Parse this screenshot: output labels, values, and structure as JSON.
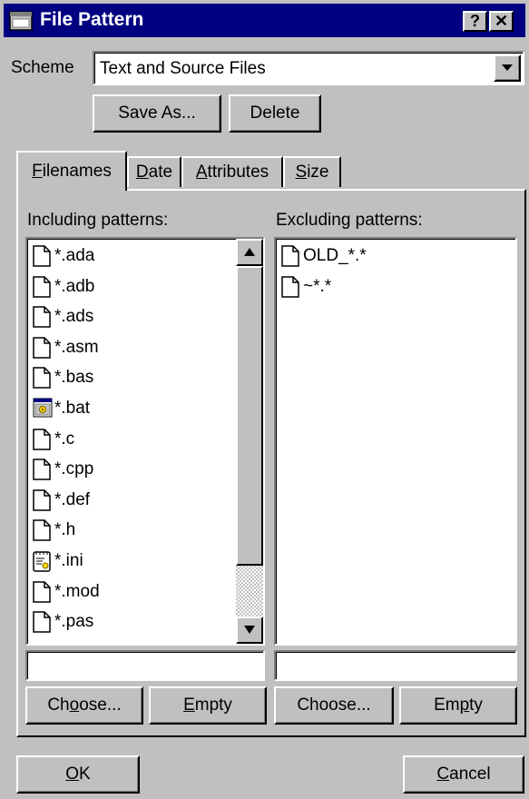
{
  "window": {
    "title": "File Pattern",
    "help_btn": "?",
    "close_btn": "✕"
  },
  "scheme": {
    "label": "Scheme",
    "value": "Text and Source Files",
    "save_as": "Save As...",
    "delete": "Delete"
  },
  "tabs": [
    {
      "label": "Filenames",
      "accel": "F",
      "rest": "ilenames"
    },
    {
      "label": "Date",
      "accel": "D",
      "rest": "ate"
    },
    {
      "label": "Attributes",
      "accel": "A",
      "rest": "ttributes"
    },
    {
      "label": "Size",
      "accel": "S",
      "rest": "ize"
    }
  ],
  "including": {
    "label": "Including patterns:",
    "items": [
      {
        "text": "*.ada",
        "icon": "document-icon"
      },
      {
        "text": "*.adb",
        "icon": "document-icon"
      },
      {
        "text": "*.ads",
        "icon": "document-icon"
      },
      {
        "text": "*.asm",
        "icon": "document-icon"
      },
      {
        "text": "*.bas",
        "icon": "document-icon"
      },
      {
        "text": "*.bat",
        "icon": "batch-file-icon"
      },
      {
        "text": "*.c",
        "icon": "document-icon"
      },
      {
        "text": "*.cpp",
        "icon": "document-icon"
      },
      {
        "text": "*.def",
        "icon": "document-icon"
      },
      {
        "text": "*.h",
        "icon": "document-icon"
      },
      {
        "text": "*.ini",
        "icon": "settings-file-icon"
      },
      {
        "text": "*.mod",
        "icon": "document-icon"
      },
      {
        "text": "*.pas",
        "icon": "document-icon"
      }
    ],
    "input_value": "",
    "choose_pre": "Ch",
    "choose_accel": "o",
    "choose_post": "ose...",
    "empty_accel": "E",
    "empty_post": "mpty"
  },
  "excluding": {
    "label": "Excluding patterns:",
    "items": [
      {
        "text": "OLD_*.*",
        "icon": "document-icon"
      },
      {
        "text": "~*.*",
        "icon": "document-icon"
      }
    ],
    "input_value": "",
    "choose": "Choose...",
    "empty_pre": "Em",
    "empty_accel": "p",
    "empty_post": "ty"
  },
  "footer": {
    "ok_accel": "O",
    "ok_post": "K",
    "cancel_accel": "C",
    "cancel_post": "ancel"
  }
}
